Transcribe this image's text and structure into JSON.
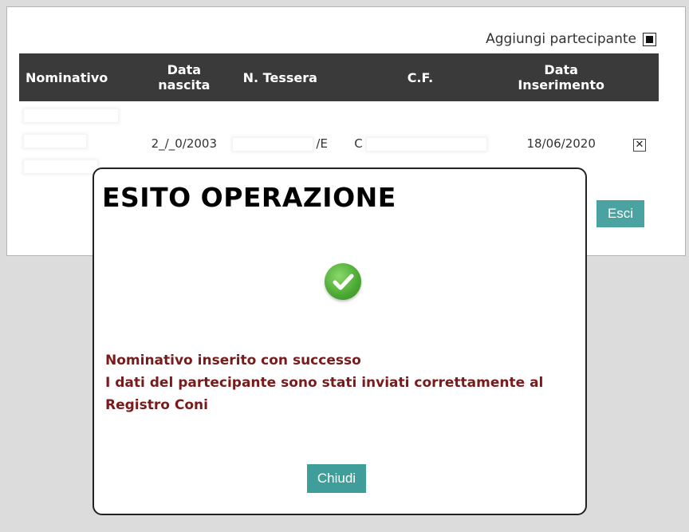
{
  "header": {
    "add_participant_label": "Aggiungi partecipante"
  },
  "table": {
    "columns": [
      "Nominativo",
      "Data\nnascita",
      "N. Tessera",
      "C.F.",
      "Data\nInserimento"
    ],
    "row": {
      "birth_date_partial": "2_/_0/2003",
      "card_number_partial": "/E",
      "cf_partial": "C",
      "insert_date": "18/06/2020",
      "remove_label": "✕"
    }
  },
  "exit_button_label": "Esci",
  "modal": {
    "title": "ESITO OPERAZIONE",
    "line1": "Nominativo inserito con successo",
    "line2": "I dati del partecipante sono stati inviati correttamente al Registro Coni",
    "close_label": "Chiudi"
  },
  "colors": {
    "header_bg": "#3a3a3a",
    "button_teal": "#3f9e9a",
    "message_text": "#7a1a1a",
    "success_green": "#4aa832"
  }
}
